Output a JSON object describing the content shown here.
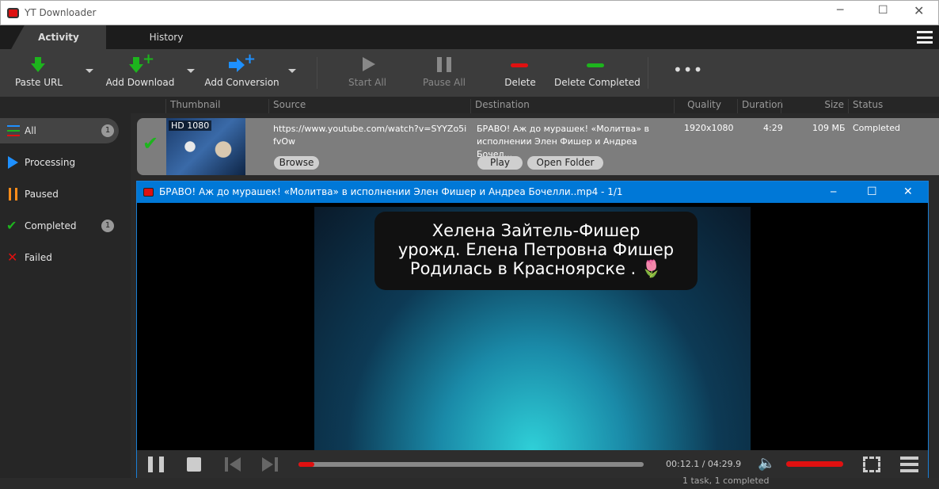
{
  "app": {
    "title": "YT Downloader"
  },
  "tabs": [
    {
      "label": "Activity"
    },
    {
      "label": "History"
    }
  ],
  "toolbar": {
    "paste_url": "Paste URL",
    "add_download": "Add Download",
    "add_conversion": "Add Conversion",
    "start_all": "Start All",
    "pause_all": "Pause All",
    "delete": "Delete",
    "delete_completed": "Delete Completed"
  },
  "columns": {
    "thumbnail": "Thumbnail",
    "source": "Source",
    "destination": "Destination",
    "quality": "Quality",
    "duration": "Duration",
    "size": "Size",
    "status": "Status"
  },
  "sidebar": {
    "items": [
      {
        "label": "All",
        "count": "1"
      },
      {
        "label": "Processing"
      },
      {
        "label": "Paused"
      },
      {
        "label": "Completed",
        "count": "1"
      },
      {
        "label": "Failed"
      }
    ]
  },
  "row": {
    "badge": "HD 1080",
    "source": "https://www.youtube.com/watch?v=SYYZo5ifvOw",
    "destination": "БРАВО! Аж до мурашек! «Молитва» в исполнении Элен Фишер и Андреа Бочел...",
    "quality": "1920x1080",
    "duration": "4:29",
    "size": "109 МБ",
    "status": "Completed",
    "browse": "Browse",
    "play": "Play",
    "open_folder": "Open Folder"
  },
  "player": {
    "title": "БРАВО! Аж до мурашек! «Молитва» в исполнении Элен Фишер и Андреа Бочелли..mp4 - 1/1",
    "subtitle": [
      "Хелена Зайтель-Фишер",
      "урожд. Елена Петровна Фишер",
      "Родилась в Красноярске . 🌷"
    ],
    "time": "00:12.1 / 04:29.9",
    "progress": 0.045,
    "volume": 1.0
  },
  "status": {
    "text": "1 task, 1 completed"
  },
  "colors": {
    "accent": "#0078d7",
    "green": "#1db41d",
    "red": "#e01010",
    "blue": "#1e90ff",
    "orange": "#ff8c1a"
  }
}
